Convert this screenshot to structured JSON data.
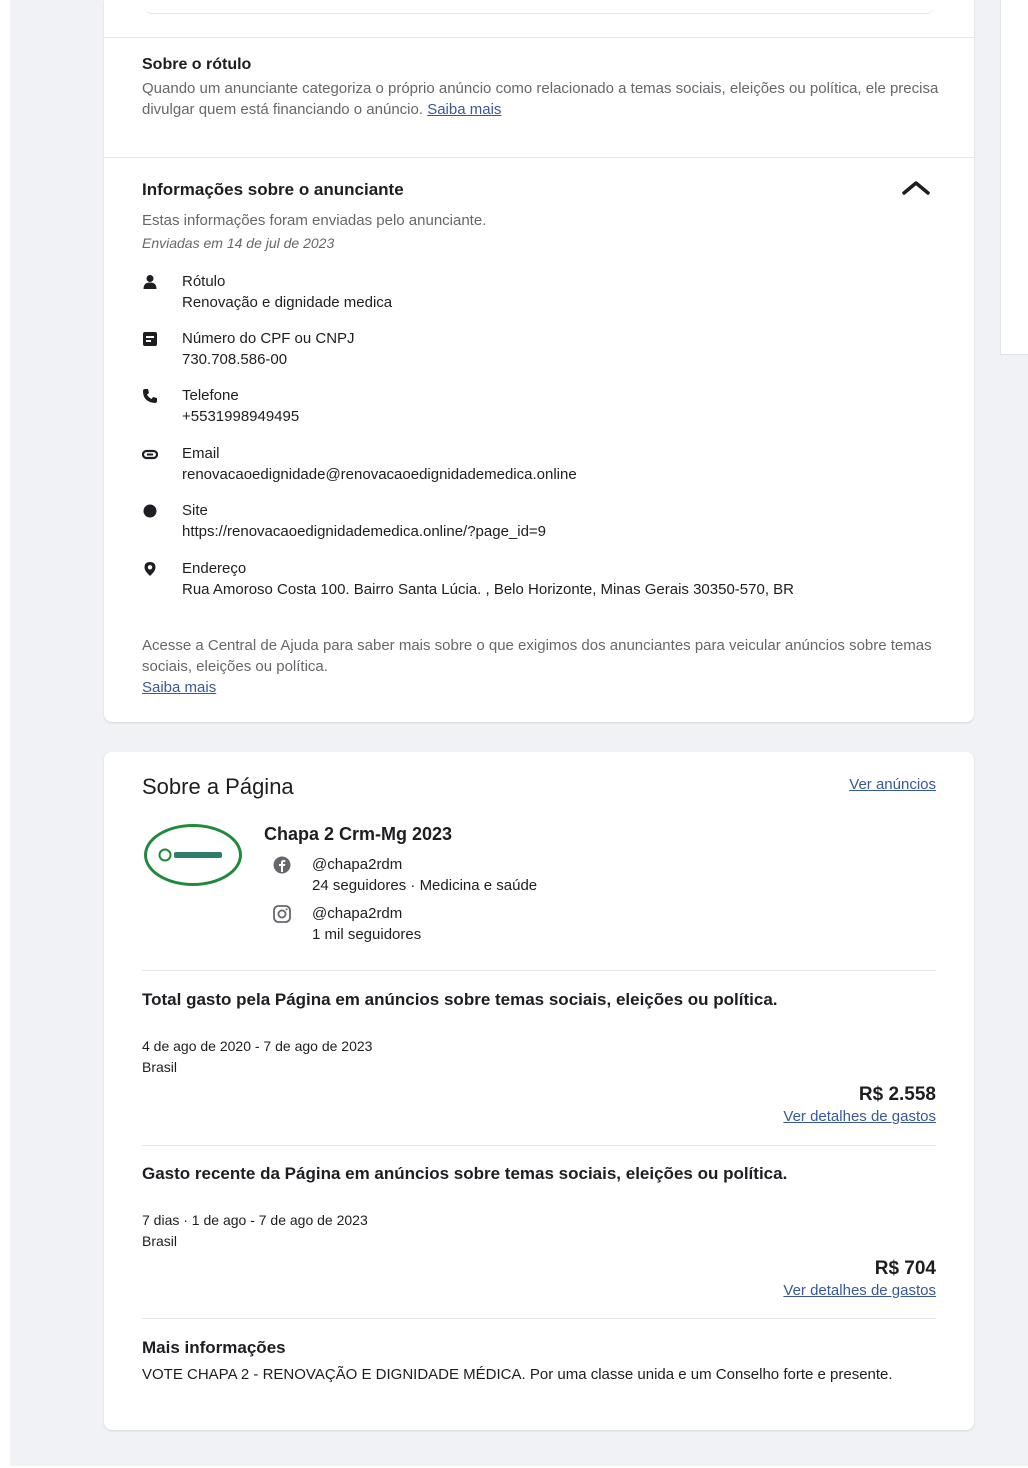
{
  "rotulo_section": {
    "title": "Sobre o rótulo",
    "description": "Quando um anunciante categoriza o próprio anúncio como relacionado a temas sociais, eleições ou política, ele precisa divulgar quem está financiando o anúncio.",
    "learn_more": "Saiba mais"
  },
  "advertiser_info": {
    "title": "Informações sobre o anunciante",
    "subtitle": "Estas informações foram enviadas pelo anunciante.",
    "sent_date": "Enviadas em 14 de jul de 2023",
    "rows": [
      {
        "icon": "person-icon",
        "label": "Rótulo",
        "value": "Renovação e dignidade medica"
      },
      {
        "icon": "id-card-icon",
        "label": "Número do CPF ou CNPJ",
        "value": "730.708.586-00"
      },
      {
        "icon": "phone-icon",
        "label": "Telefone",
        "value": "+5531998949495"
      },
      {
        "icon": "email-icon",
        "label": "Email",
        "value": "renovacaoedignidade@renovacaoedignidademedica.online"
      },
      {
        "icon": "globe-icon",
        "label": "Site",
        "value": "https://renovacaoedignidademedica.online/?page_id=9"
      },
      {
        "icon": "location-pin-icon",
        "label": "Endereço",
        "value": "Rua Amoroso Costa 100. Bairro Santa Lúcia. , Belo Horizonte, Minas Gerais 30350-570, BR"
      }
    ],
    "help_text": "Acesse a Central de Ajuda para saber mais sobre o que exigimos dos anunciantes para veicular anúncios sobre temas sociais, eleições ou política.",
    "learn_more": "Saiba mais"
  },
  "page_section": {
    "title": "Sobre a Página",
    "see_ads": "Ver anúncios",
    "page_name": "Chapa 2 Crm-Mg 2023",
    "facebook": {
      "handle": "@chapa2rdm",
      "details": "24 seguidores · Medicina e saúde"
    },
    "instagram": {
      "handle": "@chapa2rdm",
      "details": "1 mil seguidores"
    },
    "total_spend": {
      "title": "Total gasto pela Página em anúncios sobre temas sociais, eleições ou política.",
      "period": "4 de ago de 2020 - 7 de ago de 2023",
      "country": "Brasil",
      "amount": "R$ 2.558",
      "details_link": "Ver detalhes de gastos"
    },
    "recent_spend": {
      "title": "Gasto recente da Página em anúncios sobre temas sociais, eleições ou política.",
      "period": "7 dias · 1 de ago - 7 de ago de 2023",
      "country": "Brasil",
      "amount": "R$ 704",
      "details_link": "Ver detalhes de gastos"
    },
    "more_info": {
      "title": "Mais informações",
      "text": "VOTE CHAPA 2 - RENOVAÇÃO E DIGNIDADE MÉDICA. Por uma classe unida e um Conselho forte e presente."
    }
  },
  "colors": {
    "link": "#385898",
    "avatar_ring": "#1f8a3b",
    "muted_text": "#65676b"
  }
}
